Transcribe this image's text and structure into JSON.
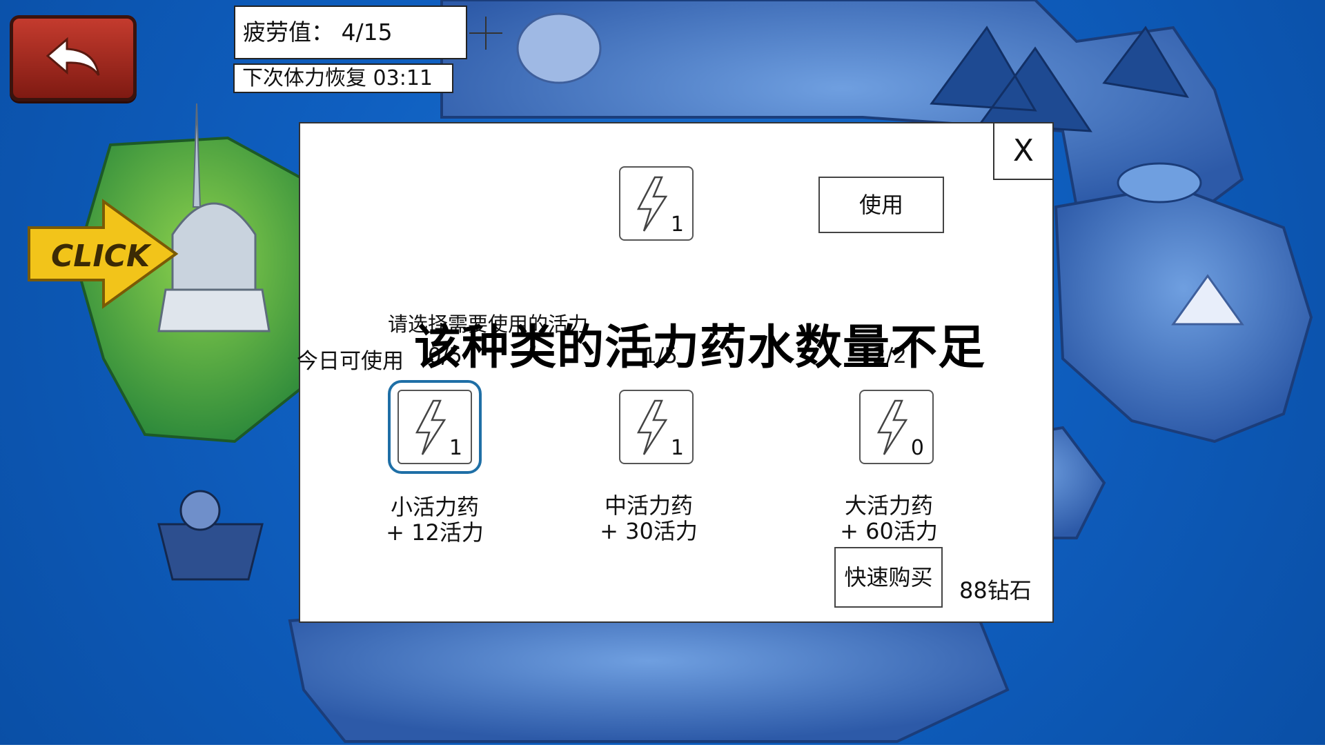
{
  "hud": {
    "fatigue_text": "疲劳值： 4/15",
    "recover_text": "下次体力恢复  03:11",
    "click_sign": "CLICK"
  },
  "dialog": {
    "close_label": "X",
    "use_label": "使用",
    "prompt": "请选择需要使用的活力",
    "today_label": "今日可使用",
    "preview_count": "1",
    "potions": [
      {
        "name": "小活力药",
        "effect": "+ 12活力",
        "count": "1",
        "today": "0/5",
        "selected": true
      },
      {
        "name": "中活力药",
        "effect": "+ 30活力",
        "count": "1",
        "today": "1/5",
        "selected": false
      },
      {
        "name": "大活力药",
        "effect": "+ 60活力",
        "count": "0",
        "today": "2/2",
        "selected": false
      }
    ],
    "quick_buy_label": "快速购买",
    "diamond_text": "88钻石"
  },
  "toast": {
    "message": "该种类的活力药水数量不足"
  },
  "colors": {
    "ocean": "#0f5fc0",
    "back_button": "#a8302a",
    "selected_frame": "#1f6fa6",
    "click_sign": "#f2c41a"
  }
}
